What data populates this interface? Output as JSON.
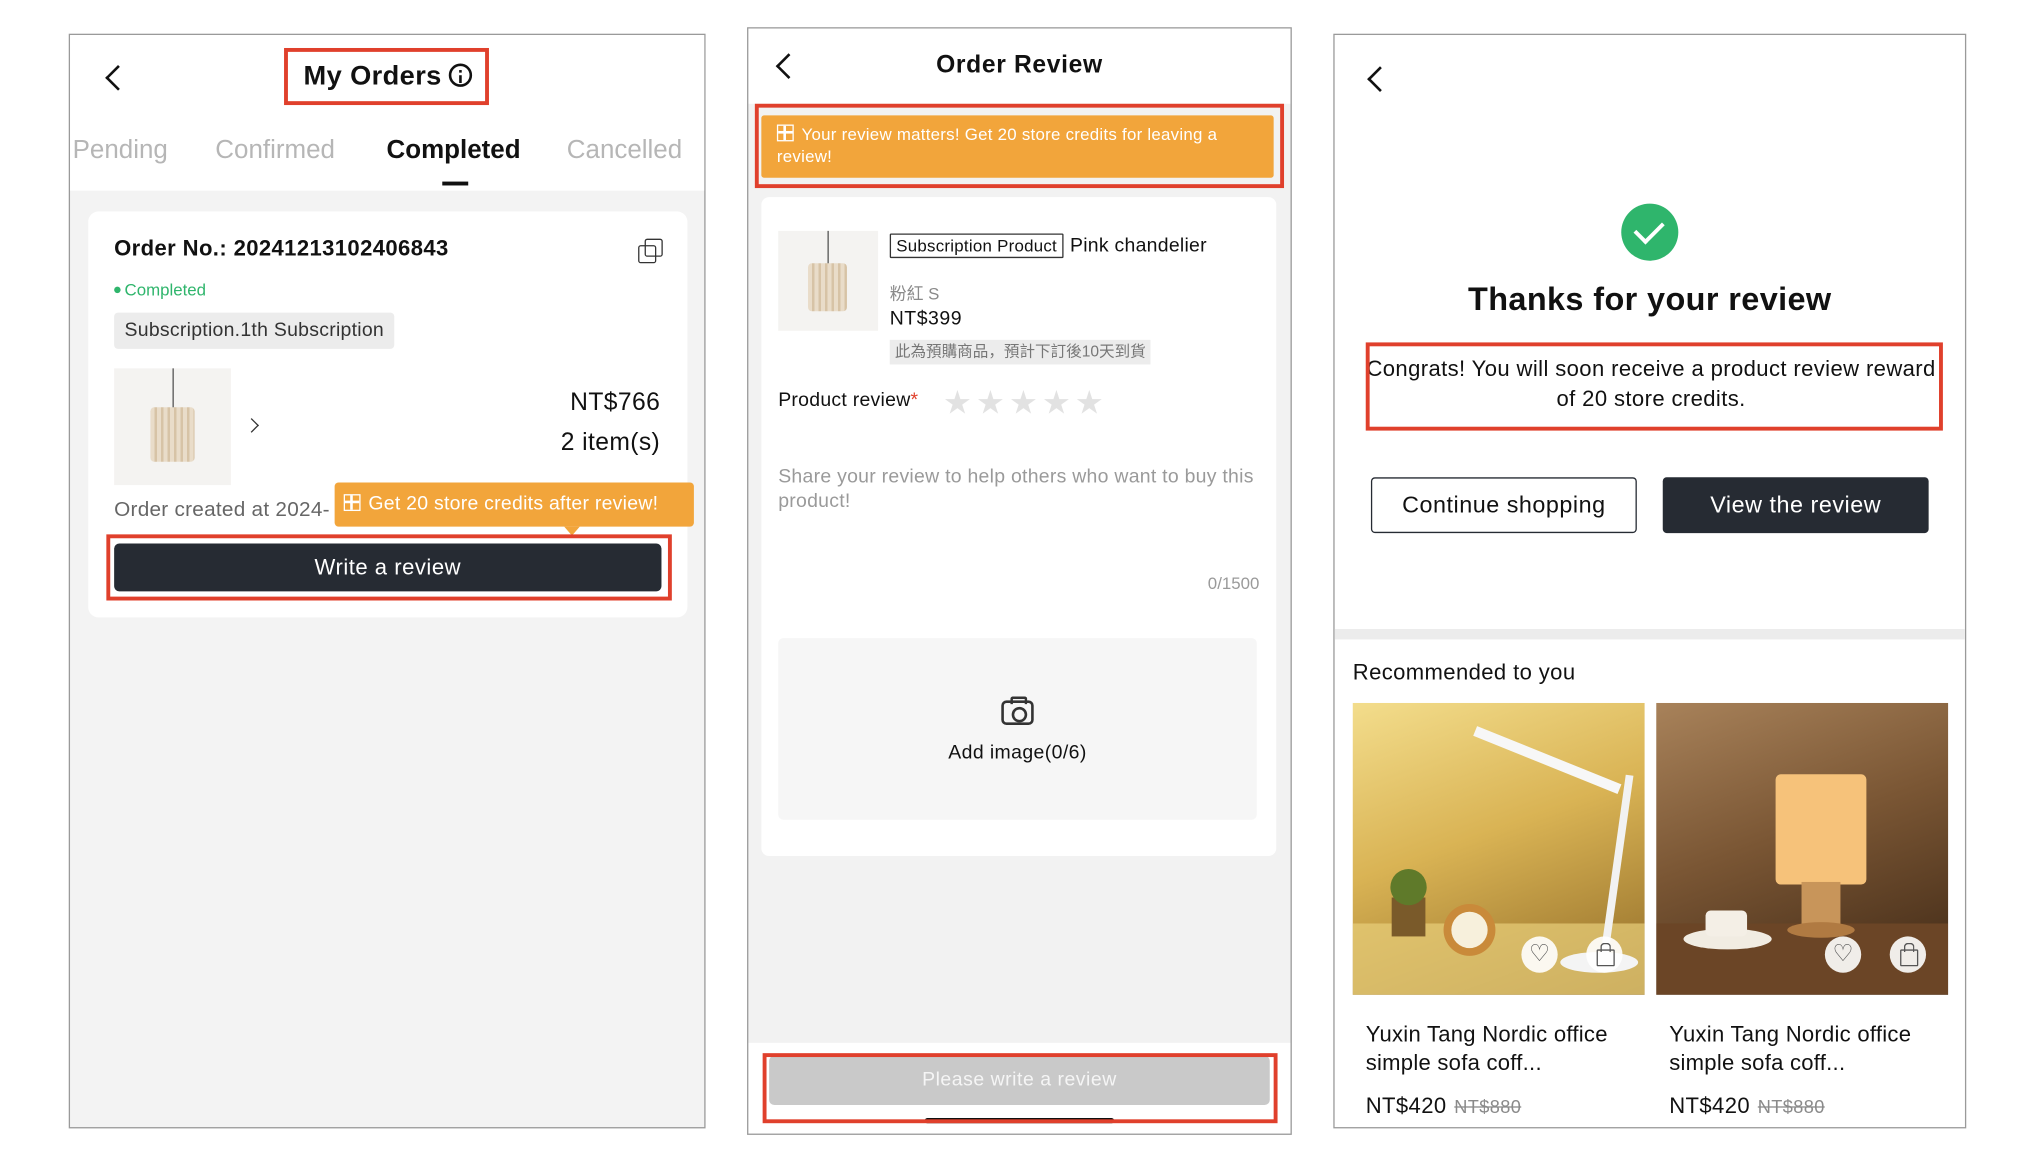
{
  "colors": {
    "accent_orange": "#f2a53b",
    "highlight_red": "#e0402c",
    "success_green": "#2fb56c",
    "button_dark": "#262b33"
  },
  "orders_screen": {
    "title": "My Orders",
    "tabs": [
      {
        "label": "Pending",
        "active": false
      },
      {
        "label": "Confirmed",
        "active": false
      },
      {
        "label": "Completed",
        "active": true
      },
      {
        "label": "Cancelled",
        "active": false
      }
    ],
    "order": {
      "order_no": "Order No.: 20241213102406843",
      "status": "Completed",
      "subscription": "Subscription.1th Subscription",
      "total": "NT$766",
      "item_count": "2 item(s)",
      "created": "Order created at 2024-"
    },
    "tooltip": "Get 20 store credits after review!",
    "write_review_button": "Write a review"
  },
  "review_screen": {
    "title": "Order Review",
    "banner": "Your review matters! Get 20 store credits for leaving a review!",
    "product": {
      "tag": "Subscription Product",
      "name": "Pink chandelier",
      "variant": "粉紅 S",
      "price": "NT$399",
      "preorder_note": "此為預購商品，預計下訂後10天到貨"
    },
    "review_label": "Product review",
    "required_mark": "*",
    "rating": {
      "value": 0,
      "max": 5
    },
    "placeholder": "Share your review to help others who want to buy this product!",
    "counter": "0/1500",
    "add_image": "Add image(0/6)",
    "submit_button": "Please write a review"
  },
  "thanks_screen": {
    "title": "Thanks for your review",
    "message": "Congrats! You will soon receive a product review reward of 20 store credits.",
    "continue_button": "Continue shopping",
    "view_button": "View the review",
    "recommended_title": "Recommended to you",
    "products": [
      {
        "name": "Yuxin Tang Nordic office simple sofa coff...",
        "price": "NT$420",
        "old_price": "NT$880"
      },
      {
        "name": "Yuxin Tang Nordic office simple sofa coff...",
        "price": "NT$420",
        "old_price": "NT$880"
      }
    ]
  }
}
